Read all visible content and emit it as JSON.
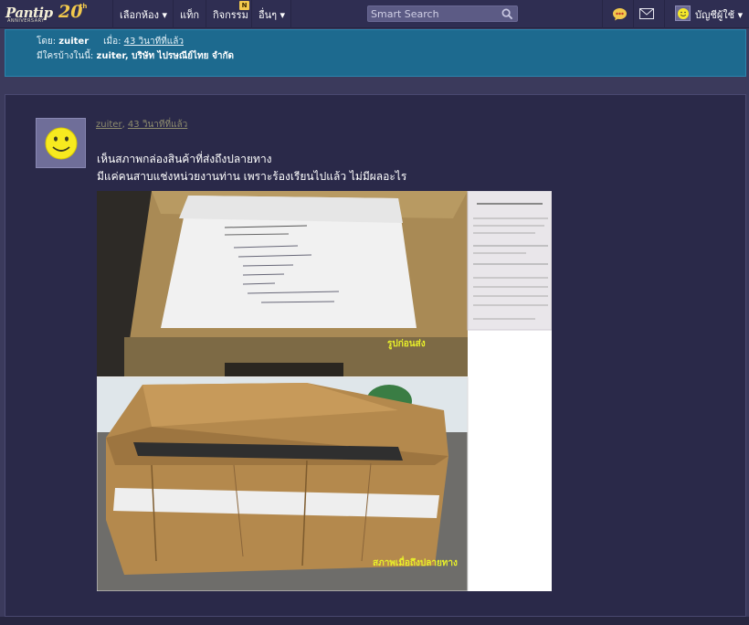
{
  "nav": {
    "logo_text": "Pantip",
    "logo_number": "20",
    "logo_suffix": "th",
    "logo_sub": "ANNIVERSARY",
    "items": [
      {
        "label": "เลือกห้อง ▾"
      },
      {
        "label": "แท็ก"
      },
      {
        "label": "กิจกรรม"
      },
      {
        "label": "อื่นๆ ▾"
      }
    ],
    "activity_badge": "N",
    "search_placeholder": "Smart Search",
    "account_label": "บัญชีผู้ใช้ ▾"
  },
  "info": {
    "by_label": "โดย:",
    "by_user": "zuiter",
    "when_label": "เมื่อ:",
    "when_value": "43 วินาทีที่แล้ว",
    "participants_label": "มีใครบ้างในนี้:",
    "participants": "zuiter, บริษัท ไปรษณีย์ไทย จำกัด"
  },
  "post": {
    "author": "zuiter",
    "time": "43 วินาทีที่แล้ว",
    "line1": "เห็นสภาพกล่องสินค้าที่ส่งถึงปลายทาง",
    "line2": "มีแค่คนสาบแช่งหน่วยงานท่าน เพราะร้องเรียนไปแล้ว ไม่มีผลอะไร",
    "caption_before": "รูปก่อนส่ง",
    "caption_after": "สภาพเมื่อถึงปลายทาง"
  },
  "colors": {
    "nav_bg": "#2f2e52",
    "info_bg": "#1d6a8f",
    "panel_bg": "#2a2949",
    "caption": "#e8ef2a"
  }
}
